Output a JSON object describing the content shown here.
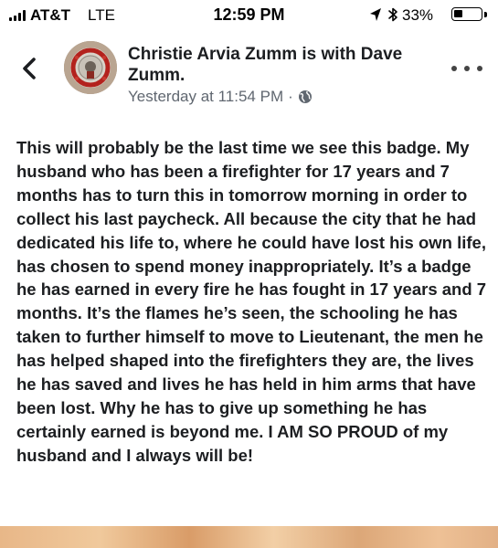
{
  "status_bar": {
    "carrier": "AT&T",
    "network": "LTE",
    "time": "12:59 PM",
    "battery_percent": "33%",
    "battery_level": 0.33,
    "icons": [
      "signal-icon",
      "location-icon",
      "bluetooth-icon",
      "battery-icon"
    ]
  },
  "post": {
    "author_line": "Christie Arvia Zumm is with Dave Zumm.",
    "timestamp": "Yesterday at 11:54 PM",
    "separator": "·",
    "privacy_icon": "globe-icon",
    "body": "This will probably be the last time we see this badge. My husband who has been a firefighter for 17 years and 7 months has to turn this in tomorrow morning in order to collect his last paycheck. All because the city that he had dedicated his life to, where he could have lost his own life, has chosen to spend money inappropriately. It’s a badge he has earned in every fire he has fought in 17 years and 7 months. It’s the flames he’s seen, the schooling he has taken to further himself to move to Lieutenant, the men he has helped shaped into the firefighters they are, the lives he has saved and lives he has held in him arms that have been lost. Why he has to give up something he has certainly earned is beyond me. I AM SO PROUD of my husband and I always will be!"
  },
  "nav": {
    "back_icon": "chevron-left-icon",
    "more_icon": "more-horizontal-icon"
  }
}
